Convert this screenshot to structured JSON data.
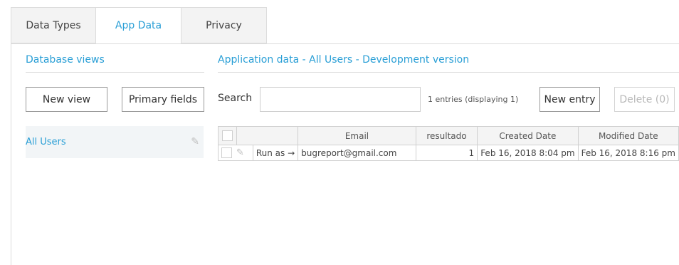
{
  "tabs": [
    {
      "label": "Data Types",
      "active": false
    },
    {
      "label": "App Data",
      "active": true
    },
    {
      "label": "Privacy",
      "active": false
    }
  ],
  "left_panel": {
    "title": "Database views",
    "new_view_label": "New view",
    "primary_fields_label": "Primary fields",
    "views": [
      {
        "label": "All Users",
        "icon": "pencil-icon"
      }
    ]
  },
  "main": {
    "title": "Application data - All Users - Development version",
    "search_label": "Search",
    "search_value": "",
    "entries_text": "1 entries (displaying 1)",
    "new_entry_label": "New entry",
    "delete_label": "Delete (0)",
    "table": {
      "columns": [
        "",
        "",
        "Email",
        "resultado",
        "Created Date",
        "Modified Date"
      ],
      "rows": [
        {
          "run_as": "Run as →",
          "email": "bugreport@gmail.com",
          "resultado": "1",
          "created": "Feb 16, 2018 8:04 pm",
          "modified": "Feb 16, 2018 8:16 pm"
        }
      ]
    }
  },
  "colors": {
    "accent": "#2a9fd6",
    "border": "#dcdcdc",
    "panel_bg": "#f2f5f7"
  }
}
